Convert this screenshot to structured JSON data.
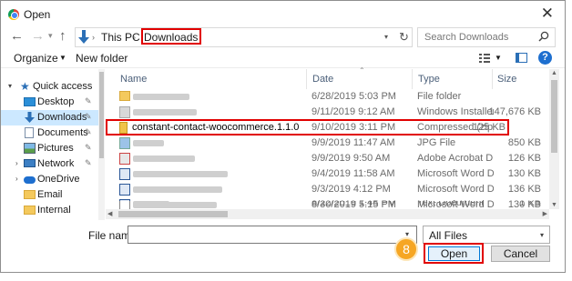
{
  "window": {
    "title": "Open",
    "app_icon": "chrome-icon",
    "close_icon": "close-icon"
  },
  "address": {
    "crumbs": [
      "This PC",
      "Downloads"
    ],
    "search_placeholder": "Search Downloads"
  },
  "toolbar": {
    "organize": "Organize",
    "new_folder": "New folder"
  },
  "nav": {
    "quick_access": "Quick access",
    "items": [
      {
        "label": "Desktop",
        "icon": "desktop-icon",
        "pinned": true
      },
      {
        "label": "Downloads",
        "icon": "download-arrow-icon",
        "pinned": true,
        "selected": true
      },
      {
        "label": "Documents",
        "icon": "documents-icon",
        "pinned": true
      },
      {
        "label": "Pictures",
        "icon": "pictures-icon",
        "pinned": true
      },
      {
        "label": "Network",
        "icon": "network-icon",
        "pinned": true
      },
      {
        "label": "OneDrive",
        "icon": "onedrive-icon",
        "pinned": false
      },
      {
        "label": "Email",
        "icon": "folder-icon",
        "pinned": false
      },
      {
        "label": "Internal",
        "icon": "folder-icon",
        "pinned": false
      }
    ]
  },
  "columns": {
    "name": "Name",
    "date": "Date",
    "type": "Type",
    "size": "Size"
  },
  "files": [
    {
      "name": "",
      "date": "6/28/2019 5:03 PM",
      "type": "File folder",
      "size": "",
      "blurred": true
    },
    {
      "name": "",
      "date": "9/11/2019 9:12 AM",
      "type": "Windows Installer ...",
      "size": "147,676 KB",
      "blurred": true
    },
    {
      "name": "constant-contact-woocommerce.1.1.0",
      "date": "9/10/2019 3:11 PM",
      "type": "Compressed (zipp...",
      "size": "125 KB",
      "blurred": false,
      "highlight": true
    },
    {
      "name": "",
      "date": "9/9/2019 11:47 AM",
      "type": "JPG File",
      "size": "850 KB",
      "blurred": true
    },
    {
      "name": "",
      "date": "9/9/2019 9:50 AM",
      "type": "Adobe Acrobat D...",
      "size": "126 KB",
      "blurred": true
    },
    {
      "name": "",
      "date": "9/4/2019 11:58 AM",
      "type": "Microsoft Word D...",
      "size": "130 KB",
      "blurred": true
    },
    {
      "name": "",
      "date": "9/3/2019 4:12 PM",
      "type": "Microsoft Word D...",
      "size": "136 KB",
      "blurred": true
    },
    {
      "name": "",
      "date": "8/30/2019 5:15 PM",
      "type": "Microsoft Word D...",
      "size": "130 KB",
      "blurred": true
    },
    {
      "name": "",
      "date": "8/22/2019 1:48 PM",
      "type": "Text Document",
      "size": "1 KB",
      "blurred": true
    }
  ],
  "bottom": {
    "file_name_label": "File name:",
    "file_name_value": "",
    "filter": "All Files",
    "open": "Open",
    "cancel": "Cancel",
    "step": "8"
  }
}
